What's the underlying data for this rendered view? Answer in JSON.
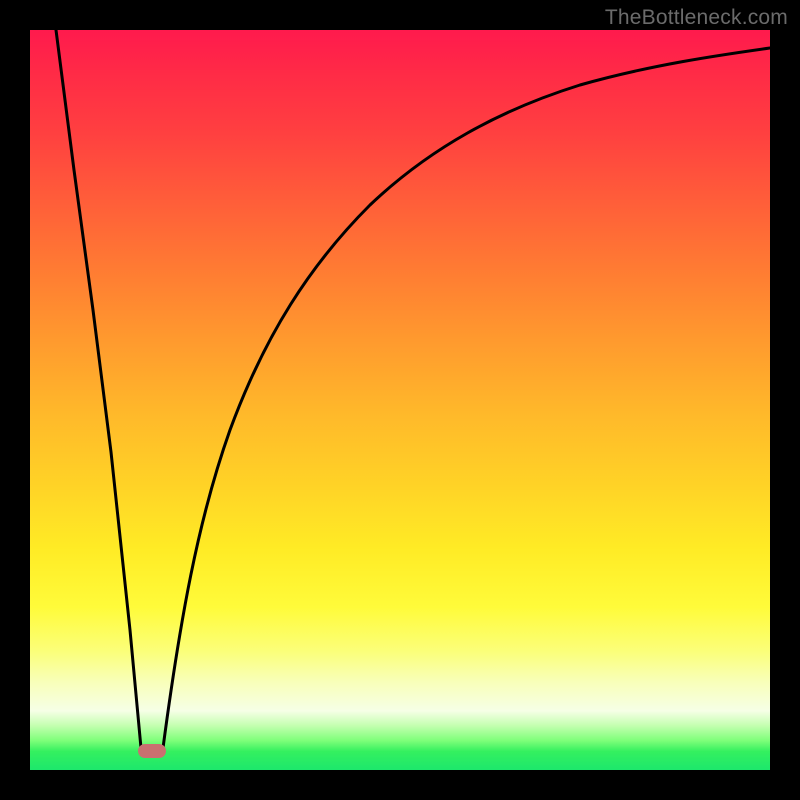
{
  "watermark": "TheBottleneck.com",
  "marker": {
    "x_frac": 0.165,
    "y_frac": 0.975
  },
  "chart_data": {
    "type": "line",
    "title": "",
    "xlabel": "",
    "ylabel": "",
    "xlim": [
      0,
      1
    ],
    "ylim": [
      0,
      1
    ],
    "series": [
      {
        "name": "left-branch",
        "x": [
          0.035,
          0.06,
          0.085,
          0.11,
          0.135,
          0.15
        ],
        "y": [
          1.0,
          0.81,
          0.62,
          0.43,
          0.19,
          0.03
        ]
      },
      {
        "name": "right-branch",
        "x": [
          0.18,
          0.195,
          0.215,
          0.24,
          0.27,
          0.305,
          0.35,
          0.41,
          0.48,
          0.56,
          0.65,
          0.74,
          0.83,
          0.92,
          1.0
        ],
        "y": [
          0.03,
          0.15,
          0.3,
          0.44,
          0.56,
          0.66,
          0.75,
          0.82,
          0.87,
          0.905,
          0.93,
          0.948,
          0.96,
          0.968,
          0.975
        ]
      }
    ],
    "annotations": [
      {
        "name": "optimal-marker",
        "x": 0.165,
        "y": 0.025
      }
    ]
  }
}
